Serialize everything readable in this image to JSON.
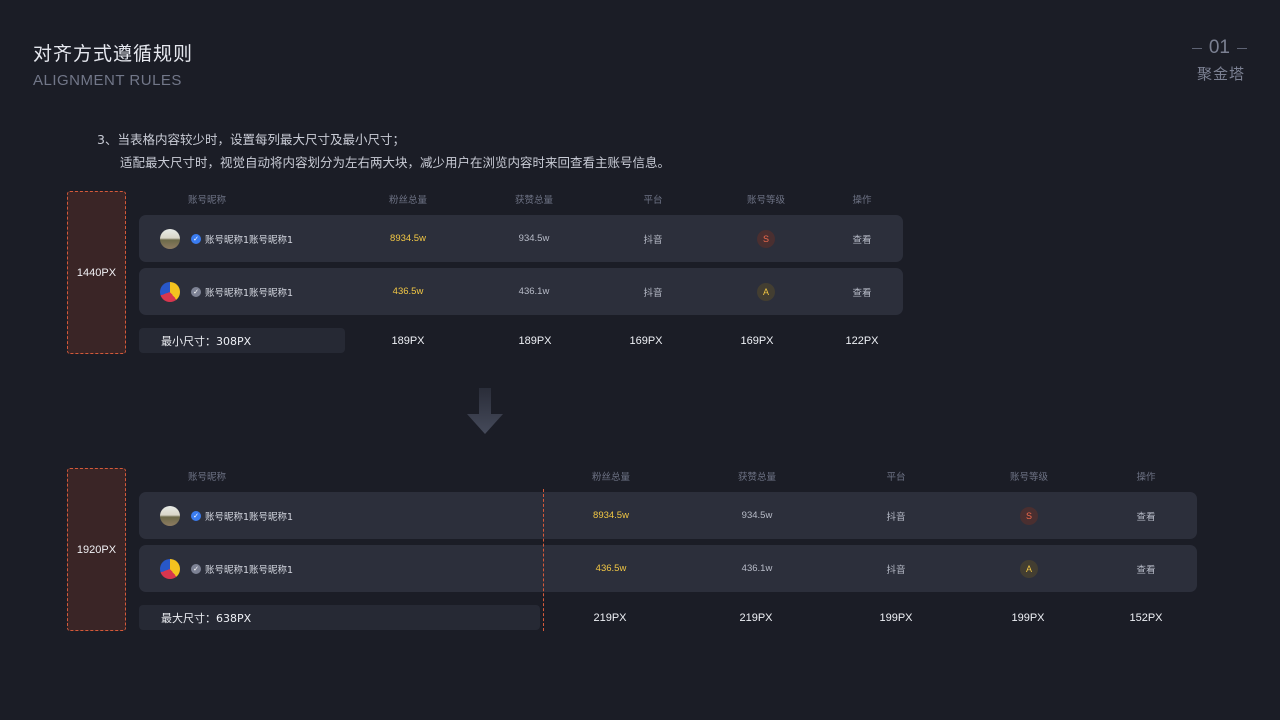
{
  "header": {
    "title_cn": "对齐方式遵循规则",
    "title_en": "ALIGNMENT RULES",
    "page_number": "01",
    "brand": "聚金塔"
  },
  "description": {
    "line1": "3、当表格内容较少时，设置每列最大尺寸及最小尺寸；",
    "line2": "适配最大尺寸时，视觉自动将内容划分为左右两大块，减少用户在浏览内容时来回查看主账号信息。"
  },
  "columns": [
    "账号昵称",
    "粉丝总量",
    "获赞总量",
    "平台",
    "账号等级",
    "操作"
  ],
  "rows": [
    {
      "name": "账号昵称1账号昵称1",
      "fans": "8934.5w",
      "likes": "934.5w",
      "platform": "抖音",
      "level": "S",
      "action": "查看",
      "verify": "blue"
    },
    {
      "name": "账号昵称1账号昵称1",
      "fans": "436.5w",
      "likes": "436.1w",
      "platform": "抖音",
      "level": "A",
      "action": "查看",
      "verify": "grey"
    }
  ],
  "table_1440": {
    "size_label": "1440PX",
    "summary_label": "最小尺寸：308PX",
    "col_sizes": [
      "189PX",
      "189PX",
      "169PX",
      "169PX",
      "122PX"
    ]
  },
  "table_1920": {
    "size_label": "1920PX",
    "summary_label": "最大尺寸：638PX",
    "col_sizes": [
      "219PX",
      "219PX",
      "199PX",
      "199PX",
      "152PX"
    ]
  },
  "colors": {
    "background": "#1b1d26",
    "row": "#2c2f3b",
    "accent_dashed": "#d4593a",
    "fans_yellow": "#f2c744",
    "level_s": "#f06a4d",
    "level_a": "#f2c744"
  },
  "icons": {
    "verified": "verified-check-icon",
    "arrow": "down-arrow-icon"
  }
}
